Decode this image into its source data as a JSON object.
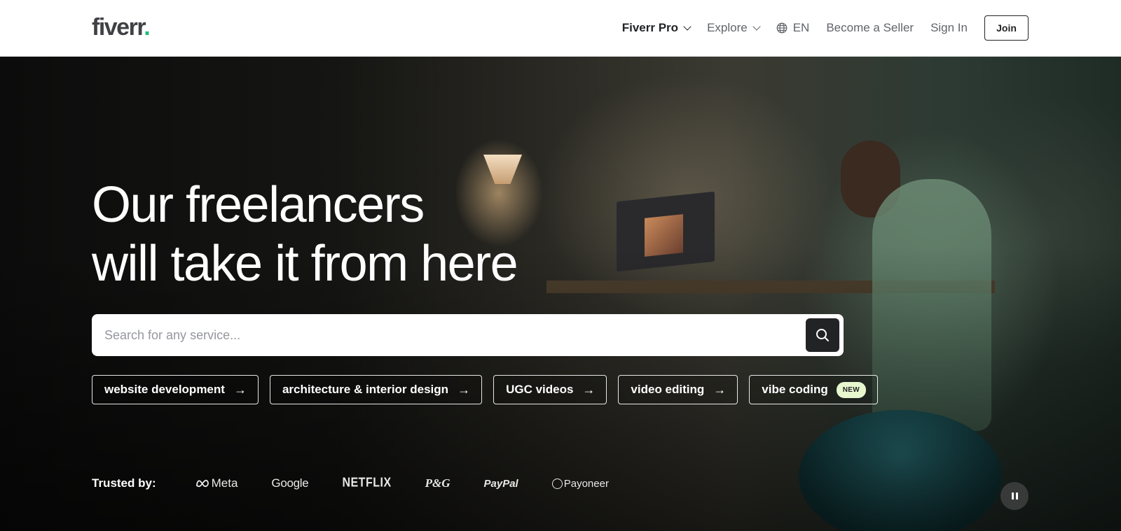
{
  "header": {
    "logo_text": "fiverr",
    "logo_dot": ".",
    "nav": {
      "fiverr_pro": "Fiverr Pro",
      "explore": "Explore",
      "language": "EN",
      "become_seller": "Become a Seller",
      "sign_in": "Sign In",
      "join": "Join"
    }
  },
  "hero": {
    "headline_line1": "Our freelancers",
    "headline_line2": "will take it from here",
    "search": {
      "placeholder": "Search for any service...",
      "value": ""
    },
    "chips": [
      {
        "label": "website development",
        "arrow": "→"
      },
      {
        "label": "architecture & interior design",
        "arrow": "→"
      },
      {
        "label": "UGC videos",
        "arrow": "→"
      },
      {
        "label": "video editing",
        "arrow": "→"
      },
      {
        "label": "vibe coding",
        "badge": "NEW"
      }
    ],
    "trusted": {
      "label": "Trusted by:",
      "logos": [
        "Meta",
        "Google",
        "NETFLIX",
        "P&G",
        "PayPal",
        "Payoneer"
      ]
    }
  },
  "colors": {
    "brand_green": "#1dbf73",
    "text_dark": "#222325",
    "text_muted": "#62646a",
    "badge_bg": "#e7f8cf"
  },
  "icons": {
    "nav_dropdown": "chevron-down-icon",
    "language": "globe-icon",
    "search": "search-icon",
    "chip_arrow": "arrow-right-icon",
    "video_control": "pause-icon"
  }
}
